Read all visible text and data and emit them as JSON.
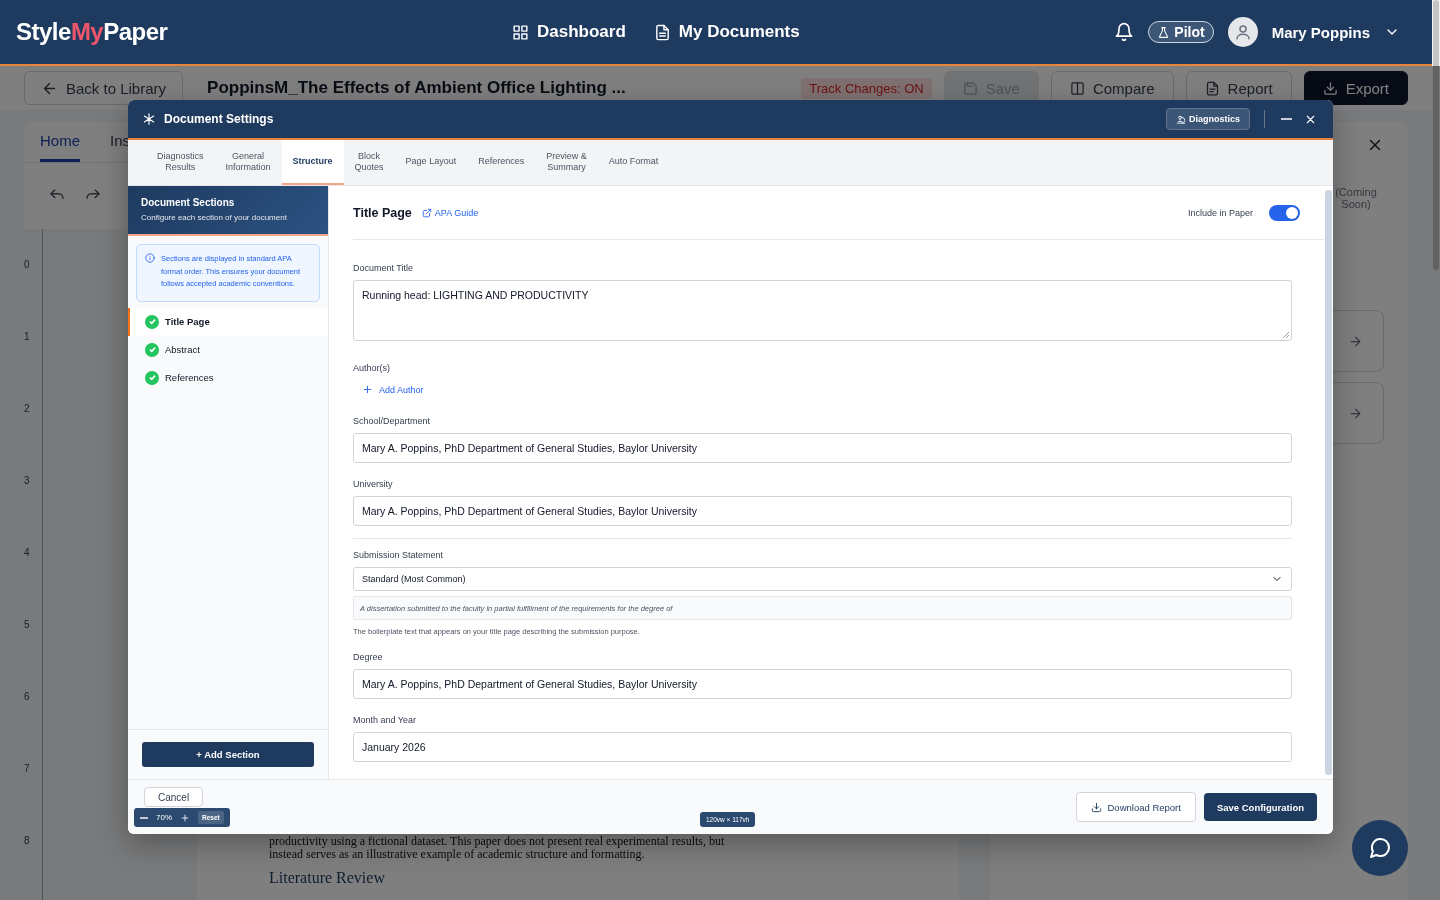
{
  "header": {
    "logo": [
      {
        "text": "Style",
        "kind": "plain"
      },
      {
        "text": "My",
        "kind": "accent"
      },
      {
        "text": "Paper",
        "kind": "plain"
      }
    ],
    "nav": [
      {
        "label": "Dashboard",
        "kind": "grid"
      },
      {
        "label": "My Documents",
        "kind": "doc"
      }
    ],
    "badge": "Pilot",
    "user": "Mary Poppins"
  },
  "toolbar": {
    "back": "Back to Library",
    "doc_title": "PoppinsM_The Effects of Ambient Office Lighting ...",
    "track_changes": "Track Changes: ON",
    "buttons": [
      {
        "label": "Save",
        "kind": "save",
        "disabled": true
      },
      {
        "label": "Compare",
        "kind": "compare",
        "disabled": false
      },
      {
        "label": "Report",
        "kind": "report",
        "disabled": false
      },
      {
        "label": "Export",
        "kind": "export",
        "disabled": false
      }
    ]
  },
  "editor": {
    "tabs": [
      {
        "label": "Home",
        "selected": true
      },
      {
        "label": "Ins",
        "selected": false
      }
    ],
    "ruler": [
      "0",
      "1",
      "2",
      "3",
      "4",
      "5",
      "6",
      "7",
      "8"
    ],
    "document": {
      "paragraph": "productivity using a fictional dataset. This paper does not present real experimental results, but instead serves as an illustrative example of academic structure and formatting.",
      "heading": "Literature Review"
    }
  },
  "side_panel": {
    "coming_soon": "(Coming Soon)"
  },
  "modal": {
    "title": "Document Settings",
    "diagnostics": "Diagnostics",
    "tabs": [
      {
        "label": "Diagnostics\nResults",
        "selected": false
      },
      {
        "label": "General\nInformation",
        "selected": false
      },
      {
        "label": "Structure",
        "selected": true
      },
      {
        "label": "Block\nQuotes",
        "selected": false
      },
      {
        "label": "Page Layout",
        "selected": false
      },
      {
        "label": "References",
        "selected": false
      },
      {
        "label": "Preview &\nSummary",
        "selected": false
      },
      {
        "label": "Auto Format",
        "selected": false
      }
    ],
    "sidebar": {
      "title": "Document Sections",
      "subtitle": "Configure each section of your document",
      "info": "Sections are displayed in standard APA format order. This ensures your document follows accepted academic conventions.",
      "sections": [
        {
          "label": "Title Page",
          "selected": true,
          "complete": true
        },
        {
          "label": "Abstract",
          "selected": false,
          "complete": true
        },
        {
          "label": "References",
          "selected": false,
          "complete": true
        }
      ],
      "add_button": "+ Add Section"
    },
    "main": {
      "title": "Title Page",
      "guide_link": "APA Guide",
      "include": {
        "label": "Include in Paper",
        "on": true
      },
      "fields": [
        {
          "kind": "textarea",
          "label": "Document Title",
          "value": "Running head: LIGHTING AND PRODUCTIVITY"
        },
        {
          "kind": "add",
          "label": "Author(s)",
          "action": "Add Author"
        },
        {
          "kind": "input",
          "label": "School/Department",
          "value": "Mary A. Poppins, PhD Department of General Studies, Baylor University"
        },
        {
          "kind": "input",
          "label": "University",
          "value": "Mary A. Poppins, PhD Department of General Studies, Baylor University"
        },
        {
          "kind": "select",
          "label": "Submission Statement",
          "value": "Standard (Most Common)",
          "preview": "A dissertation submitted to the faculty in partial fulfillment of the requirements for the degree of",
          "help": "The boilerplate text that appears on your title page describing the submission purpose."
        },
        {
          "kind": "input",
          "label": "Degree",
          "value": "Mary A. Poppins, PhD Department of General Studies, Baylor University"
        },
        {
          "kind": "input",
          "label": "Month and Year",
          "value": "January 2026"
        }
      ]
    },
    "footer": {
      "cancel": "Cancel",
      "download": "Download Report",
      "save": "Save Configuration"
    }
  },
  "zoom_control": {
    "value": "70%",
    "reset": "Reset"
  },
  "viewport_badge": "120vw × 117vh"
}
